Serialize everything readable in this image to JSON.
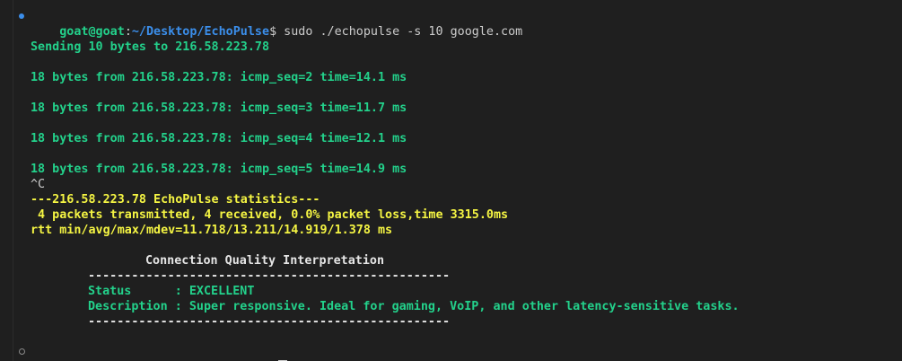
{
  "prompt": {
    "user_host": "goat@goat",
    "sep": ":",
    "path": "~/Desktop/EchoPulse",
    "symbol": "$"
  },
  "command": " sudo ./echopulse -s 10 google.com",
  "output": {
    "sending": "Sending 10 bytes to 216.58.223.78",
    "replies": [
      "18 bytes from 216.58.223.78: icmp_seq=2 time=14.1 ms",
      "18 bytes from 216.58.223.78: icmp_seq=3 time=11.7 ms",
      "18 bytes from 216.58.223.78: icmp_seq=4 time=12.1 ms",
      "18 bytes from 216.58.223.78: icmp_seq=5 time=14.9 ms"
    ],
    "interrupt": "^C",
    "stats_header": "---216.58.223.78 EchoPulse statistics---",
    "stats_packets": " 4 packets transmitted, 4 received, 0.0% packet loss,time 3315.0ms",
    "stats_rtt": "rtt min/avg/max/mdev=11.718/13.211/14.919/1.378 ms",
    "quality_title": "Connection Quality Interpretation",
    "divider": "--------------------------------------------------",
    "status_line": "Status      : EXCELLENT",
    "description_line": "Description : Super responsive. Ideal for gaming, VoIP, and other latency-sensitive tasks."
  },
  "colors": {
    "background": "#1f1f1f",
    "green": "#23d18b",
    "yellow": "#f5f543",
    "blue": "#3b8eea",
    "text": "#cccccc"
  }
}
